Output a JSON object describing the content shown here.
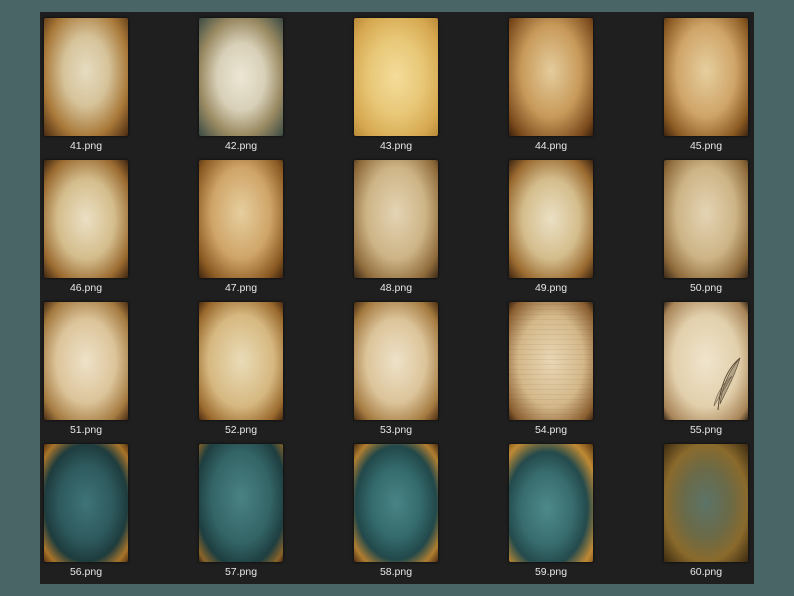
{
  "files": [
    {
      "name": "41.png",
      "style": "p1"
    },
    {
      "name": "42.png",
      "style": "p2"
    },
    {
      "name": "43.png",
      "style": "p3"
    },
    {
      "name": "44.png",
      "style": "p4"
    },
    {
      "name": "45.png",
      "style": "p5"
    },
    {
      "name": "46.png",
      "style": "p6"
    },
    {
      "name": "47.png",
      "style": "p5"
    },
    {
      "name": "48.png",
      "style": "p7"
    },
    {
      "name": "49.png",
      "style": "p6"
    },
    {
      "name": "50.png",
      "style": "p7"
    },
    {
      "name": "51.png",
      "style": "p8"
    },
    {
      "name": "52.png",
      "style": "p9"
    },
    {
      "name": "53.png",
      "style": "p8"
    },
    {
      "name": "54.png",
      "style": "p10"
    },
    {
      "name": "55.png",
      "style": "p11"
    },
    {
      "name": "56.png",
      "style": "t1"
    },
    {
      "name": "57.png",
      "style": "t2"
    },
    {
      "name": "58.png",
      "style": "t3"
    },
    {
      "name": "59.png",
      "style": "t4"
    },
    {
      "name": "60.png",
      "style": "t5"
    }
  ],
  "colors": {
    "page_background": "#4a6566",
    "panel_background": "#1f1f1f",
    "label_text": "#e8e8e8"
  }
}
